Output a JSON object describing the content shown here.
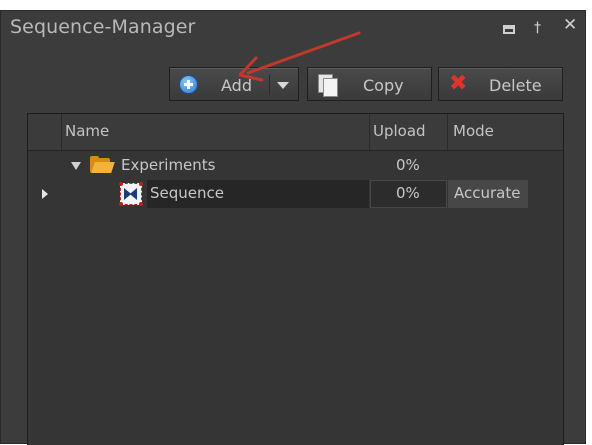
{
  "window": {
    "title": "Sequence-Manager",
    "controls": [
      "minimize-icon",
      "pin-icon",
      "close-icon"
    ],
    "pin_glyph": "†",
    "close_glyph": "✕"
  },
  "toolbar": {
    "add_label": "Add",
    "copy_label": "Copy",
    "delete_label": "Delete",
    "delete_glyph": "✖"
  },
  "grid": {
    "columns": [
      "Name",
      "Upload",
      "Mode"
    ],
    "rows": [
      {
        "name": "Experiments",
        "upload": "0%",
        "mode": "",
        "type": "folder",
        "expanded": true
      },
      {
        "name": "Sequence",
        "upload": "0%",
        "mode": "Accurate",
        "type": "sequence",
        "selected": true
      }
    ]
  },
  "colors": {
    "panel_bg": "#3c3c3c",
    "grid_bg": "#353535",
    "text": "#c8c8c8",
    "annotation_arrow": "#c0392b",
    "delete_icon": "#e0342a",
    "add_icon": "#2b74c9"
  }
}
